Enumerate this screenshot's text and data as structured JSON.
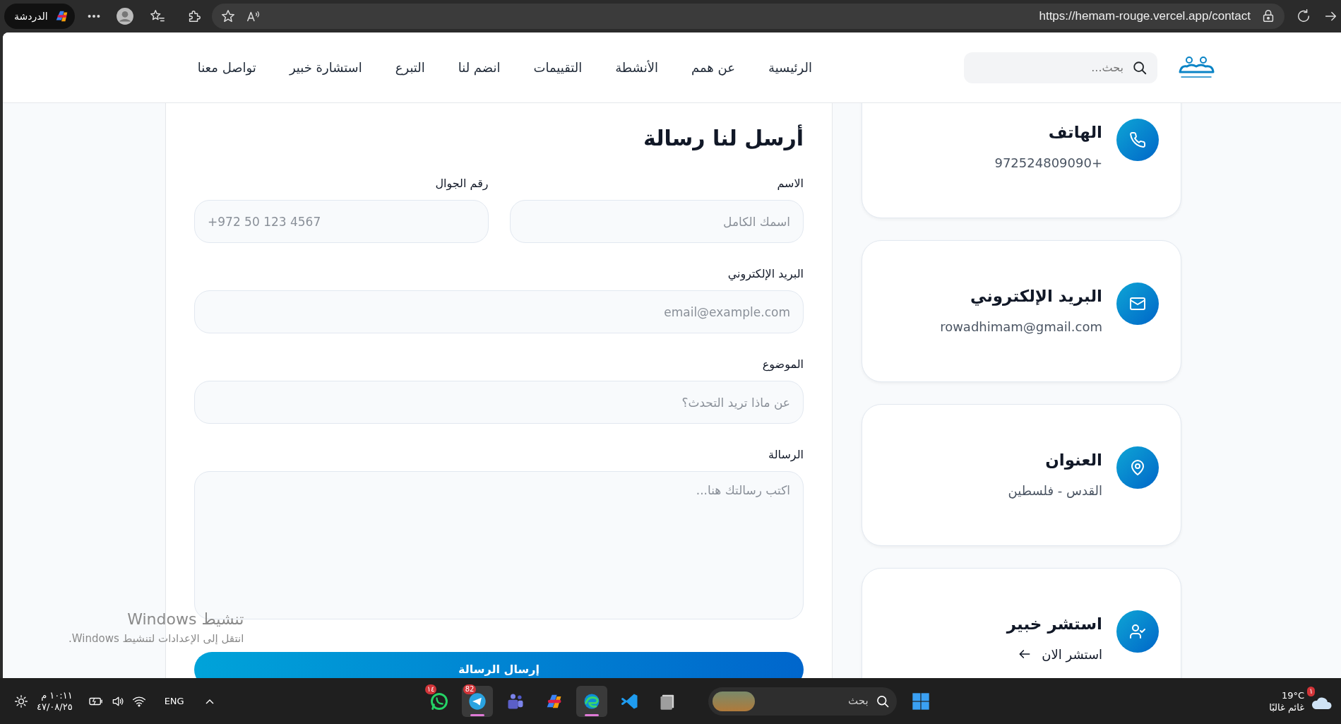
{
  "browser": {
    "chat_button": "الدردشة",
    "url": "https://hemam-rouge.vercel.app/contact"
  },
  "header": {
    "search": {
      "placeholder": "بحث..."
    },
    "nav": [
      "الرئيسية",
      "عن همم",
      "الأنشطة",
      "التقييمات",
      "انضم لنا",
      "التبرع",
      "استشارة خبير",
      "تواصل معنا"
    ]
  },
  "form": {
    "title": "أرسل لنا رسالة",
    "rows": [
      [
        {
          "kind": "input",
          "label": "الاسم",
          "placeholder": "اسمك الكامل"
        },
        {
          "kind": "phone",
          "label": "رقم الجوال",
          "placeholder": "+972 50 123 4567"
        }
      ],
      [
        {
          "kind": "input",
          "label": "البريد الإلكتروني",
          "placeholder": "email@example.com"
        }
      ],
      [
        {
          "kind": "input",
          "label": "الموضوع",
          "placeholder": "عن ماذا تريد التحدث؟"
        }
      ],
      [
        {
          "kind": "textarea",
          "label": "الرسالة",
          "placeholder": "اكتب رسالتك هنا..."
        }
      ]
    ],
    "submit": "إرسال الرسالة"
  },
  "contact_cards": [
    {
      "kind": "phone",
      "title": "الهاتف",
      "text": "+972524809090"
    },
    {
      "kind": "email",
      "title": "البريد الإلكتروني",
      "text": "rowadhimam@gmail.com"
    },
    {
      "kind": "address",
      "title": "العنوان",
      "text": "القدس - فلسطين"
    },
    {
      "kind": "consult",
      "title": "استشر خبير",
      "link": "استشر الان"
    }
  ],
  "activation_notice": {
    "title": "تنشيط Windows",
    "text": "انتقل إلى الإعدادات لتنشيط Windows."
  },
  "taskbar": {
    "time": "١٠:١١ م",
    "date": "٤٧/٠٨/٢٥",
    "language": "ENG",
    "apps": [
      {
        "kind": "files",
        "active": false
      },
      {
        "kind": "vscode",
        "active": false
      },
      {
        "kind": "edge",
        "active": true
      },
      {
        "kind": "copilot",
        "active": false
      },
      {
        "kind": "teams",
        "active": false
      },
      {
        "kind": "telegram",
        "badge": "82",
        "active": true
      },
      {
        "kind": "whatsapp",
        "badge": "١٤",
        "active": false
      }
    ],
    "search": {
      "placeholder": "بحث"
    },
    "weather": {
      "temperature": "19°C",
      "condition": "غائم غالبًا",
      "badge": "١"
    }
  }
}
